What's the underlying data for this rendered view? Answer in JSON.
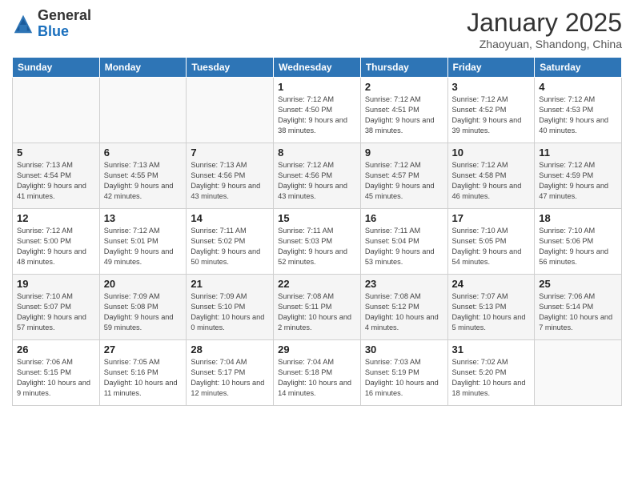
{
  "header": {
    "logo_general": "General",
    "logo_blue": "Blue",
    "month_title": "January 2025",
    "subtitle": "Zhaoyuan, Shandong, China"
  },
  "days_of_week": [
    "Sunday",
    "Monday",
    "Tuesday",
    "Wednesday",
    "Thursday",
    "Friday",
    "Saturday"
  ],
  "weeks": [
    [
      {
        "day": "",
        "info": ""
      },
      {
        "day": "",
        "info": ""
      },
      {
        "day": "",
        "info": ""
      },
      {
        "day": "1",
        "info": "Sunrise: 7:12 AM\nSunset: 4:50 PM\nDaylight: 9 hours and 38 minutes."
      },
      {
        "day": "2",
        "info": "Sunrise: 7:12 AM\nSunset: 4:51 PM\nDaylight: 9 hours and 38 minutes."
      },
      {
        "day": "3",
        "info": "Sunrise: 7:12 AM\nSunset: 4:52 PM\nDaylight: 9 hours and 39 minutes."
      },
      {
        "day": "4",
        "info": "Sunrise: 7:12 AM\nSunset: 4:53 PM\nDaylight: 9 hours and 40 minutes."
      }
    ],
    [
      {
        "day": "5",
        "info": "Sunrise: 7:13 AM\nSunset: 4:54 PM\nDaylight: 9 hours and 41 minutes."
      },
      {
        "day": "6",
        "info": "Sunrise: 7:13 AM\nSunset: 4:55 PM\nDaylight: 9 hours and 42 minutes."
      },
      {
        "day": "7",
        "info": "Sunrise: 7:13 AM\nSunset: 4:56 PM\nDaylight: 9 hours and 43 minutes."
      },
      {
        "day": "8",
        "info": "Sunrise: 7:12 AM\nSunset: 4:56 PM\nDaylight: 9 hours and 43 minutes."
      },
      {
        "day": "9",
        "info": "Sunrise: 7:12 AM\nSunset: 4:57 PM\nDaylight: 9 hours and 45 minutes."
      },
      {
        "day": "10",
        "info": "Sunrise: 7:12 AM\nSunset: 4:58 PM\nDaylight: 9 hours and 46 minutes."
      },
      {
        "day": "11",
        "info": "Sunrise: 7:12 AM\nSunset: 4:59 PM\nDaylight: 9 hours and 47 minutes."
      }
    ],
    [
      {
        "day": "12",
        "info": "Sunrise: 7:12 AM\nSunset: 5:00 PM\nDaylight: 9 hours and 48 minutes."
      },
      {
        "day": "13",
        "info": "Sunrise: 7:12 AM\nSunset: 5:01 PM\nDaylight: 9 hours and 49 minutes."
      },
      {
        "day": "14",
        "info": "Sunrise: 7:11 AM\nSunset: 5:02 PM\nDaylight: 9 hours and 50 minutes."
      },
      {
        "day": "15",
        "info": "Sunrise: 7:11 AM\nSunset: 5:03 PM\nDaylight: 9 hours and 52 minutes."
      },
      {
        "day": "16",
        "info": "Sunrise: 7:11 AM\nSunset: 5:04 PM\nDaylight: 9 hours and 53 minutes."
      },
      {
        "day": "17",
        "info": "Sunrise: 7:10 AM\nSunset: 5:05 PM\nDaylight: 9 hours and 54 minutes."
      },
      {
        "day": "18",
        "info": "Sunrise: 7:10 AM\nSunset: 5:06 PM\nDaylight: 9 hours and 56 minutes."
      }
    ],
    [
      {
        "day": "19",
        "info": "Sunrise: 7:10 AM\nSunset: 5:07 PM\nDaylight: 9 hours and 57 minutes."
      },
      {
        "day": "20",
        "info": "Sunrise: 7:09 AM\nSunset: 5:08 PM\nDaylight: 9 hours and 59 minutes."
      },
      {
        "day": "21",
        "info": "Sunrise: 7:09 AM\nSunset: 5:10 PM\nDaylight: 10 hours and 0 minutes."
      },
      {
        "day": "22",
        "info": "Sunrise: 7:08 AM\nSunset: 5:11 PM\nDaylight: 10 hours and 2 minutes."
      },
      {
        "day": "23",
        "info": "Sunrise: 7:08 AM\nSunset: 5:12 PM\nDaylight: 10 hours and 4 minutes."
      },
      {
        "day": "24",
        "info": "Sunrise: 7:07 AM\nSunset: 5:13 PM\nDaylight: 10 hours and 5 minutes."
      },
      {
        "day": "25",
        "info": "Sunrise: 7:06 AM\nSunset: 5:14 PM\nDaylight: 10 hours and 7 minutes."
      }
    ],
    [
      {
        "day": "26",
        "info": "Sunrise: 7:06 AM\nSunset: 5:15 PM\nDaylight: 10 hours and 9 minutes."
      },
      {
        "day": "27",
        "info": "Sunrise: 7:05 AM\nSunset: 5:16 PM\nDaylight: 10 hours and 11 minutes."
      },
      {
        "day": "28",
        "info": "Sunrise: 7:04 AM\nSunset: 5:17 PM\nDaylight: 10 hours and 12 minutes."
      },
      {
        "day": "29",
        "info": "Sunrise: 7:04 AM\nSunset: 5:18 PM\nDaylight: 10 hours and 14 minutes."
      },
      {
        "day": "30",
        "info": "Sunrise: 7:03 AM\nSunset: 5:19 PM\nDaylight: 10 hours and 16 minutes."
      },
      {
        "day": "31",
        "info": "Sunrise: 7:02 AM\nSunset: 5:20 PM\nDaylight: 10 hours and 18 minutes."
      },
      {
        "day": "",
        "info": ""
      }
    ]
  ]
}
